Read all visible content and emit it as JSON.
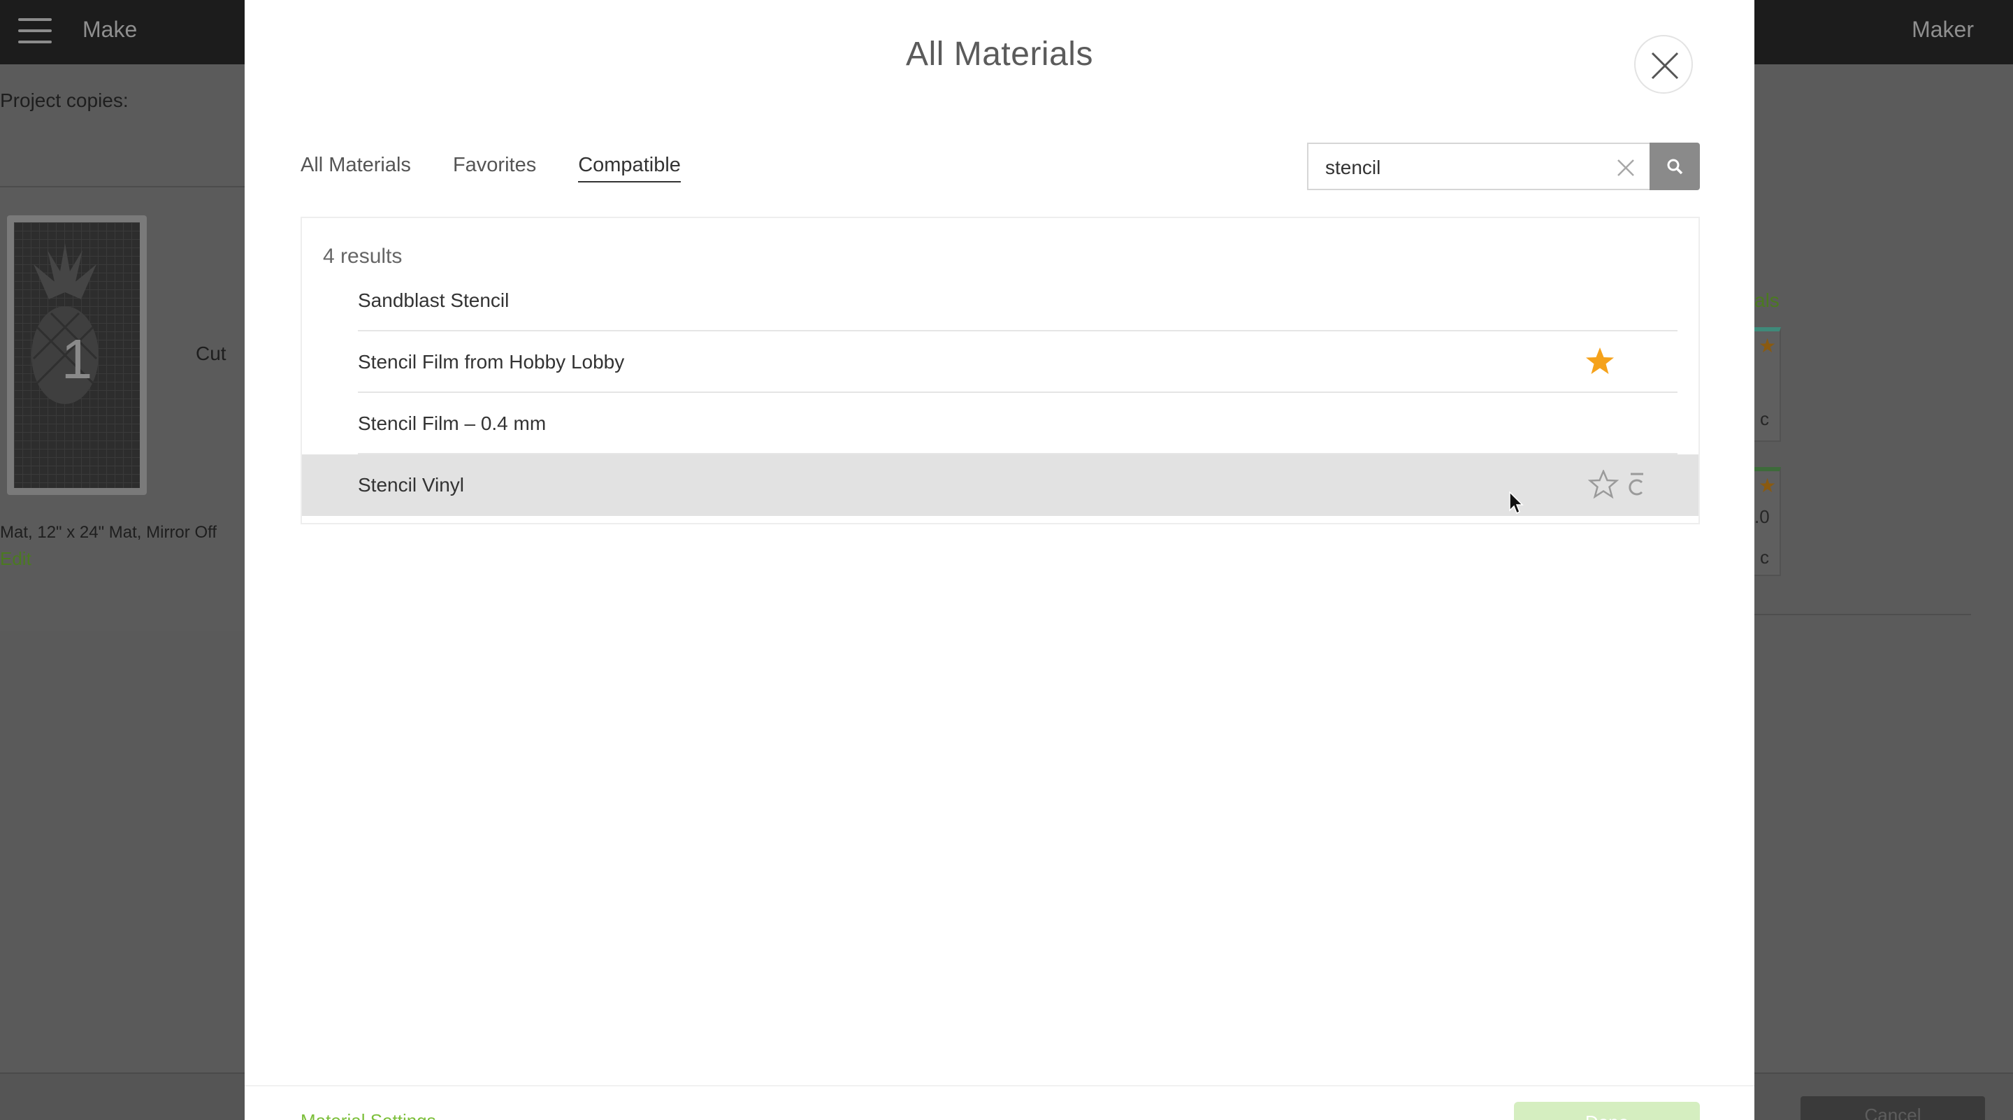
{
  "app": {
    "title": "Make",
    "machine": "Maker"
  },
  "background": {
    "project_copies_label": "Project copies:",
    "mat_number": "1",
    "cut_label": "Cut",
    "mat_info": "Mat, 12\" x 24\" Mat, Mirror Off",
    "edit_label": "Edit",
    "materials_link": "als",
    "card2_value": ".0",
    "card_icon_text": "c",
    "cancel_label": "Cancel"
  },
  "modal": {
    "title": "All Materials",
    "tabs": [
      {
        "label": "All Materials",
        "active": false
      },
      {
        "label": "Favorites",
        "active": false
      },
      {
        "label": "Compatible",
        "active": true
      }
    ],
    "search": {
      "value": "stencil"
    },
    "results_count": "4 results",
    "results": [
      {
        "name": "Sandblast Stencil",
        "favorite": false,
        "hovered": false
      },
      {
        "name": "Stencil Film from Hobby Lobby",
        "favorite": true,
        "hovered": false
      },
      {
        "name": "Stencil Film – 0.4 mm",
        "favorite": false,
        "hovered": false
      },
      {
        "name": "Stencil Vinyl",
        "favorite": false,
        "hovered": true
      }
    ],
    "footer": {
      "material_settings": "Material Settings",
      "done": "Done"
    }
  },
  "colors": {
    "accent_green": "#7cbf3a",
    "favorite_star": "#f5a21b",
    "header_bg": "#1c1c1c"
  }
}
